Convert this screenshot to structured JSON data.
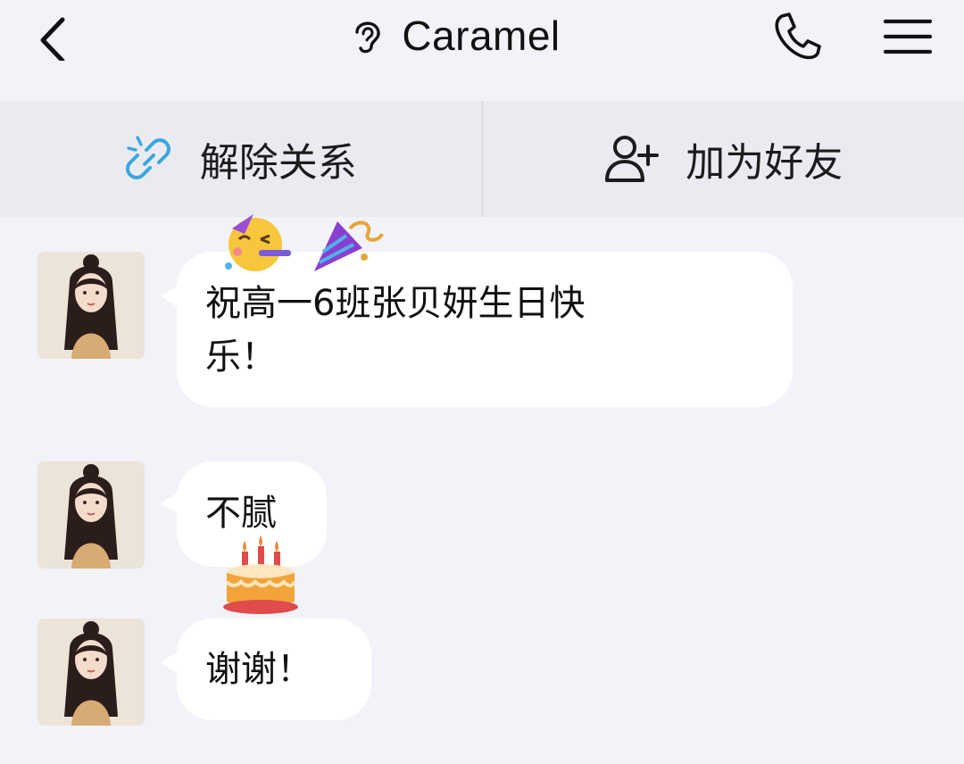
{
  "header": {
    "title": "Caramel",
    "icons": {
      "back": "back-arrow-icon",
      "ear": "ear-icon",
      "phone": "phone-icon",
      "menu": "menu-icon"
    }
  },
  "actions": {
    "unbind_label": "解除关系",
    "add_friend_label": "加为好友"
  },
  "messages": [
    {
      "text_line1": "祝高一6班张贝妍生日快",
      "text_line2": "乐！",
      "sticker": "party-face-emoji"
    },
    {
      "text": "不腻",
      "sticker": "birthday-cake-emoji"
    },
    {
      "text": "谢谢！"
    }
  ],
  "colors": {
    "background": "#f2f3f8",
    "action_bar": "#eaebf0",
    "bubble": "#ffffff",
    "link_icon": "#3aa6de"
  }
}
